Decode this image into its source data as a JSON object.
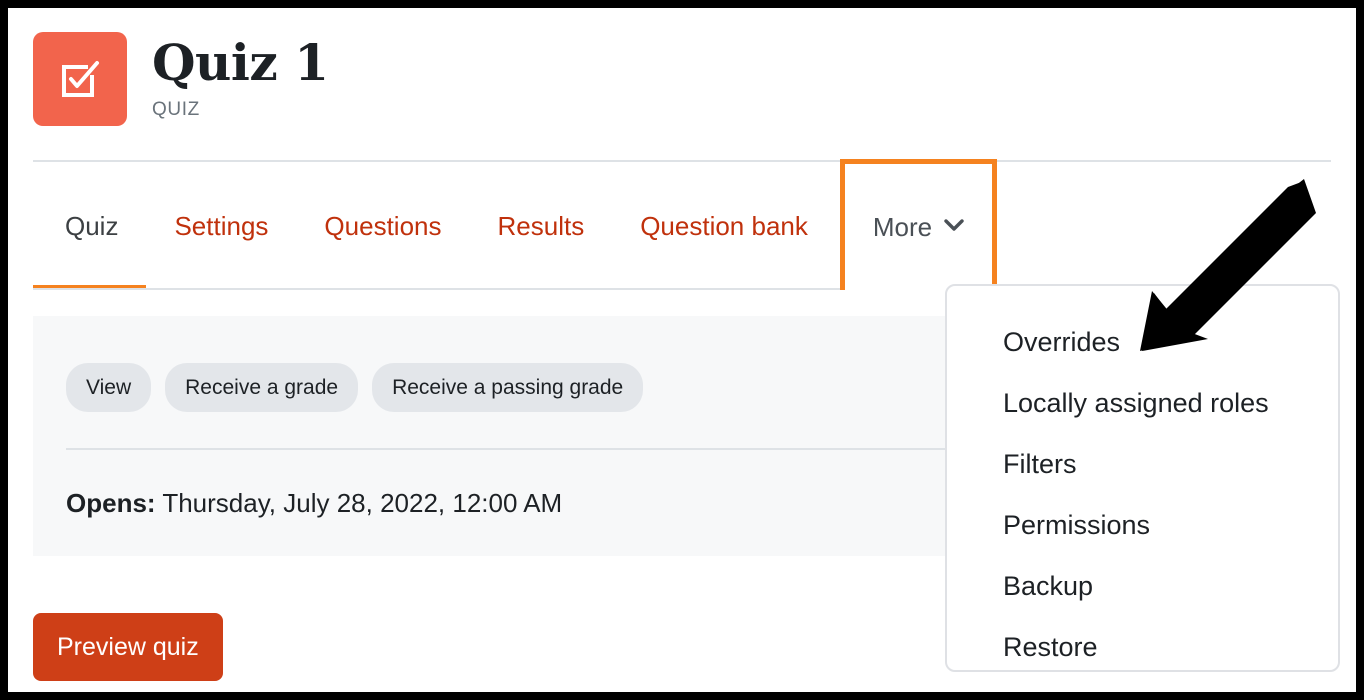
{
  "header": {
    "title": "Quiz 1",
    "subtitle": "QUIZ",
    "icon": "quiz-checkbox-icon",
    "icon_bg": "#F2644C"
  },
  "tabs": [
    {
      "label": "Quiz",
      "active": true,
      "name": "tab-quiz"
    },
    {
      "label": "Settings",
      "active": false,
      "name": "tab-settings"
    },
    {
      "label": "Questions",
      "active": false,
      "name": "tab-questions"
    },
    {
      "label": "Results",
      "active": false,
      "name": "tab-results"
    },
    {
      "label": "Question bank",
      "active": false,
      "name": "tab-question-bank"
    }
  ],
  "more_tab": {
    "label": "More",
    "chevron": "⌄",
    "highlight_color": "#F5821F"
  },
  "more_menu": {
    "items": [
      {
        "label": "Overrides",
        "name": "menu-item-overrides"
      },
      {
        "label": "Locally assigned roles",
        "name": "menu-item-locally-assigned-roles"
      },
      {
        "label": "Filters",
        "name": "menu-item-filters"
      },
      {
        "label": "Permissions",
        "name": "menu-item-permissions"
      },
      {
        "label": "Backup",
        "name": "menu-item-backup"
      },
      {
        "label": "Restore",
        "name": "menu-item-restore"
      }
    ]
  },
  "info_panel": {
    "badges": [
      {
        "label": "View"
      },
      {
        "label": "Receive a grade"
      },
      {
        "label": "Receive a passing grade"
      }
    ],
    "opens_label": "Opens:",
    "opens_value": "Thursday, July 28, 2022, 12:00 AM"
  },
  "actions": {
    "preview_quiz": "Preview quiz"
  },
  "annotation": {
    "arrow": "black-arrow-pointing-to-overrides"
  },
  "colors": {
    "accent_orange": "#F5821F",
    "link_red": "#C0310C",
    "button_red": "#CE3F17",
    "icon_coral": "#F2644C",
    "panel_bg": "#F7F8F9",
    "badge_bg": "#E3E6EA"
  }
}
